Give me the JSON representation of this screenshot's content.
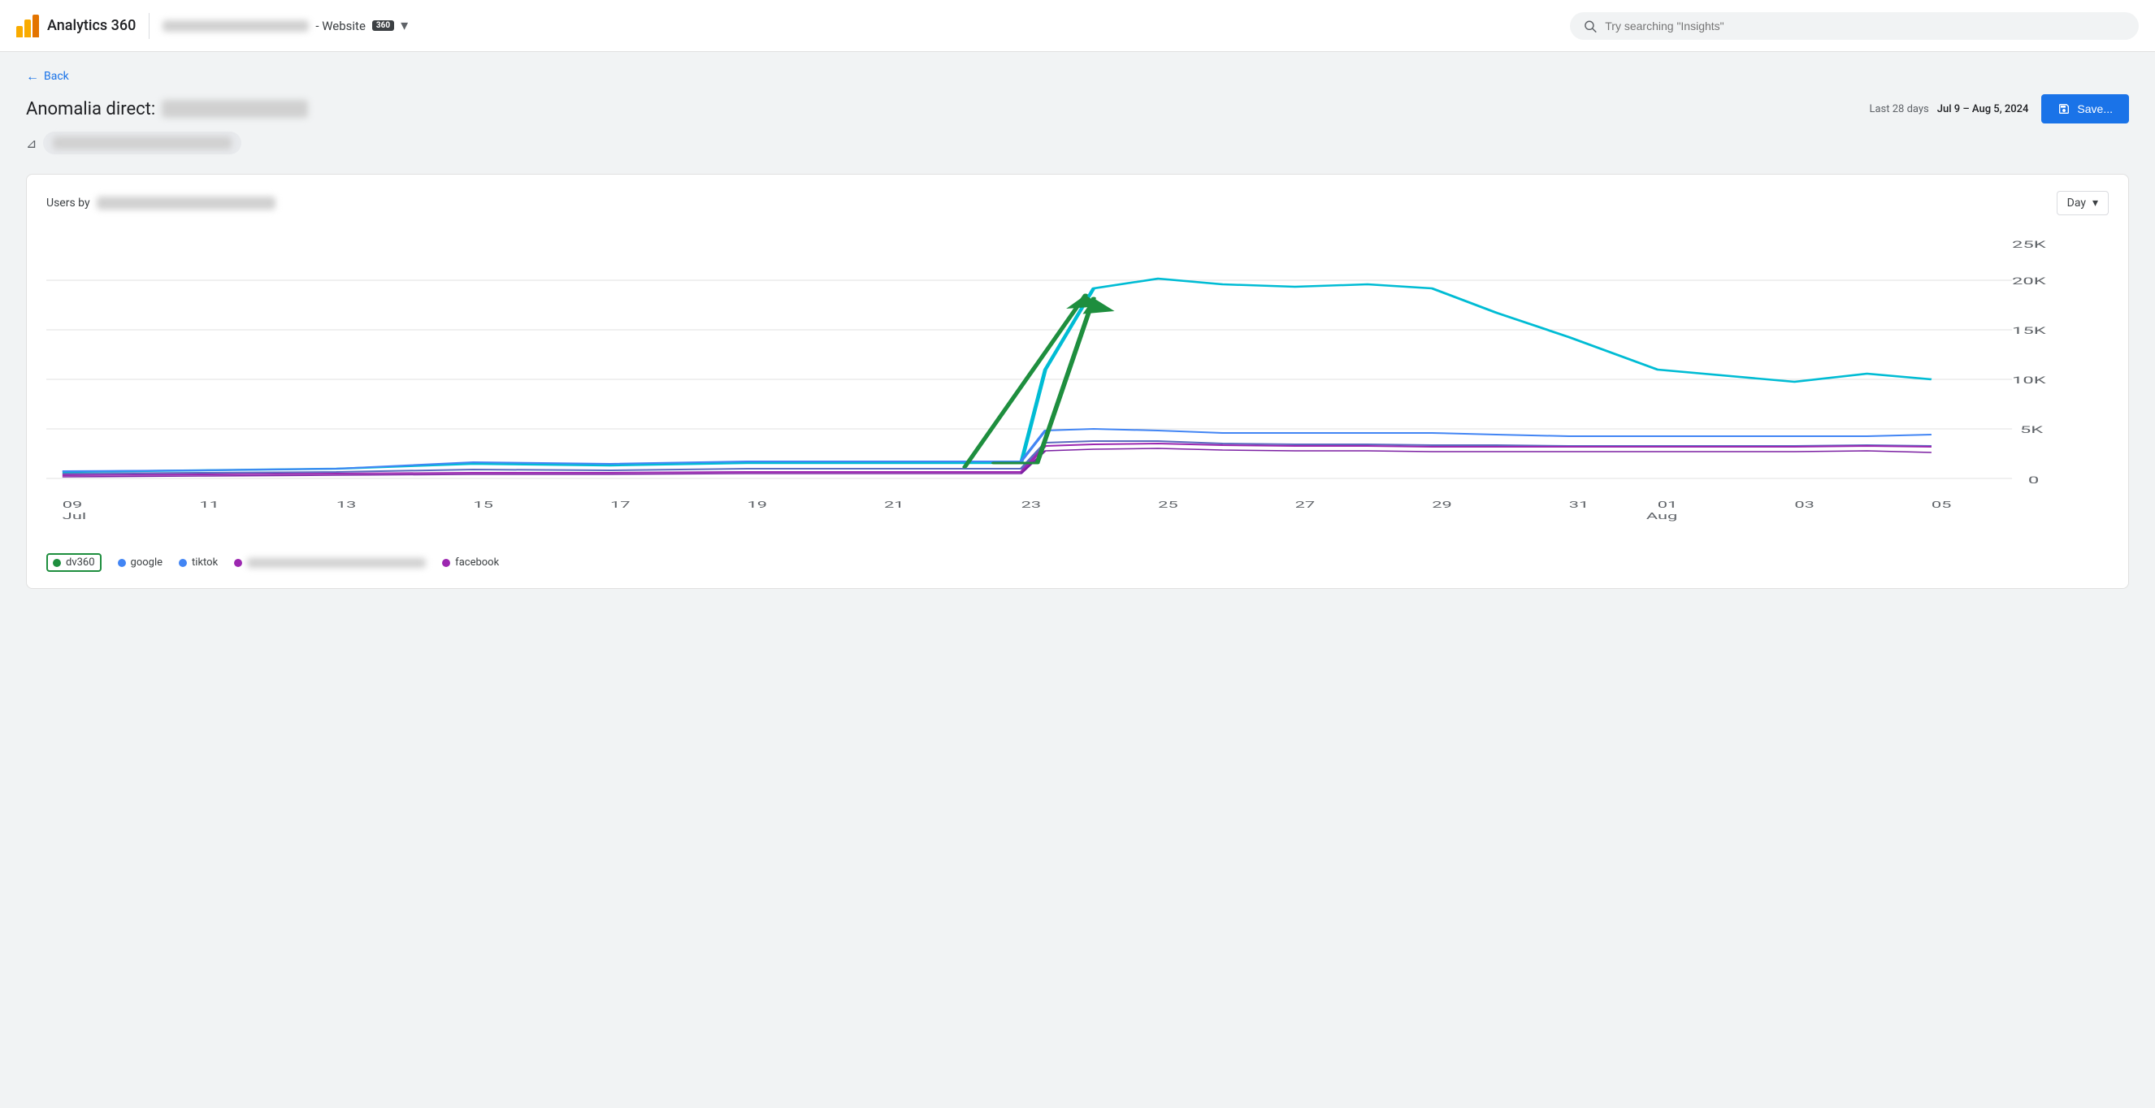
{
  "brand": {
    "title": "Analytics 360"
  },
  "nav": {
    "property_label": "- Website",
    "badge": "360",
    "search_placeholder": "Try searching \"Insights\""
  },
  "back_label": "Back",
  "page": {
    "title_prefix": "Anomalia direct:",
    "date_label": "Last 28 days",
    "date_value": "Jul 9 – Aug 5, 2024",
    "save_label": "Save..."
  },
  "chart": {
    "title_prefix": "Users by",
    "granularity": "Day",
    "y_labels": [
      "0",
      "5K",
      "10K",
      "15K",
      "20K",
      "25K"
    ],
    "x_labels": [
      "09\nJul",
      "11",
      "13",
      "15",
      "17",
      "19",
      "21",
      "23",
      "25",
      "27",
      "29",
      "31",
      "01\nAug",
      "03",
      "05"
    ]
  },
  "legend": [
    {
      "key": "dv360",
      "label": "dv360",
      "color": "#1e8e3e",
      "outlined": true
    },
    {
      "key": "google",
      "label": "google",
      "color": "#4285f4",
      "outlined": false
    },
    {
      "key": "tiktok",
      "label": "tiktok",
      "color": "#4285f4",
      "outlined": false
    },
    {
      "key": "blurred",
      "label": "",
      "color": "#9c27b0",
      "outlined": false
    },
    {
      "key": "facebook",
      "label": "facebook",
      "color": "#9c27b0",
      "outlined": false
    }
  ]
}
